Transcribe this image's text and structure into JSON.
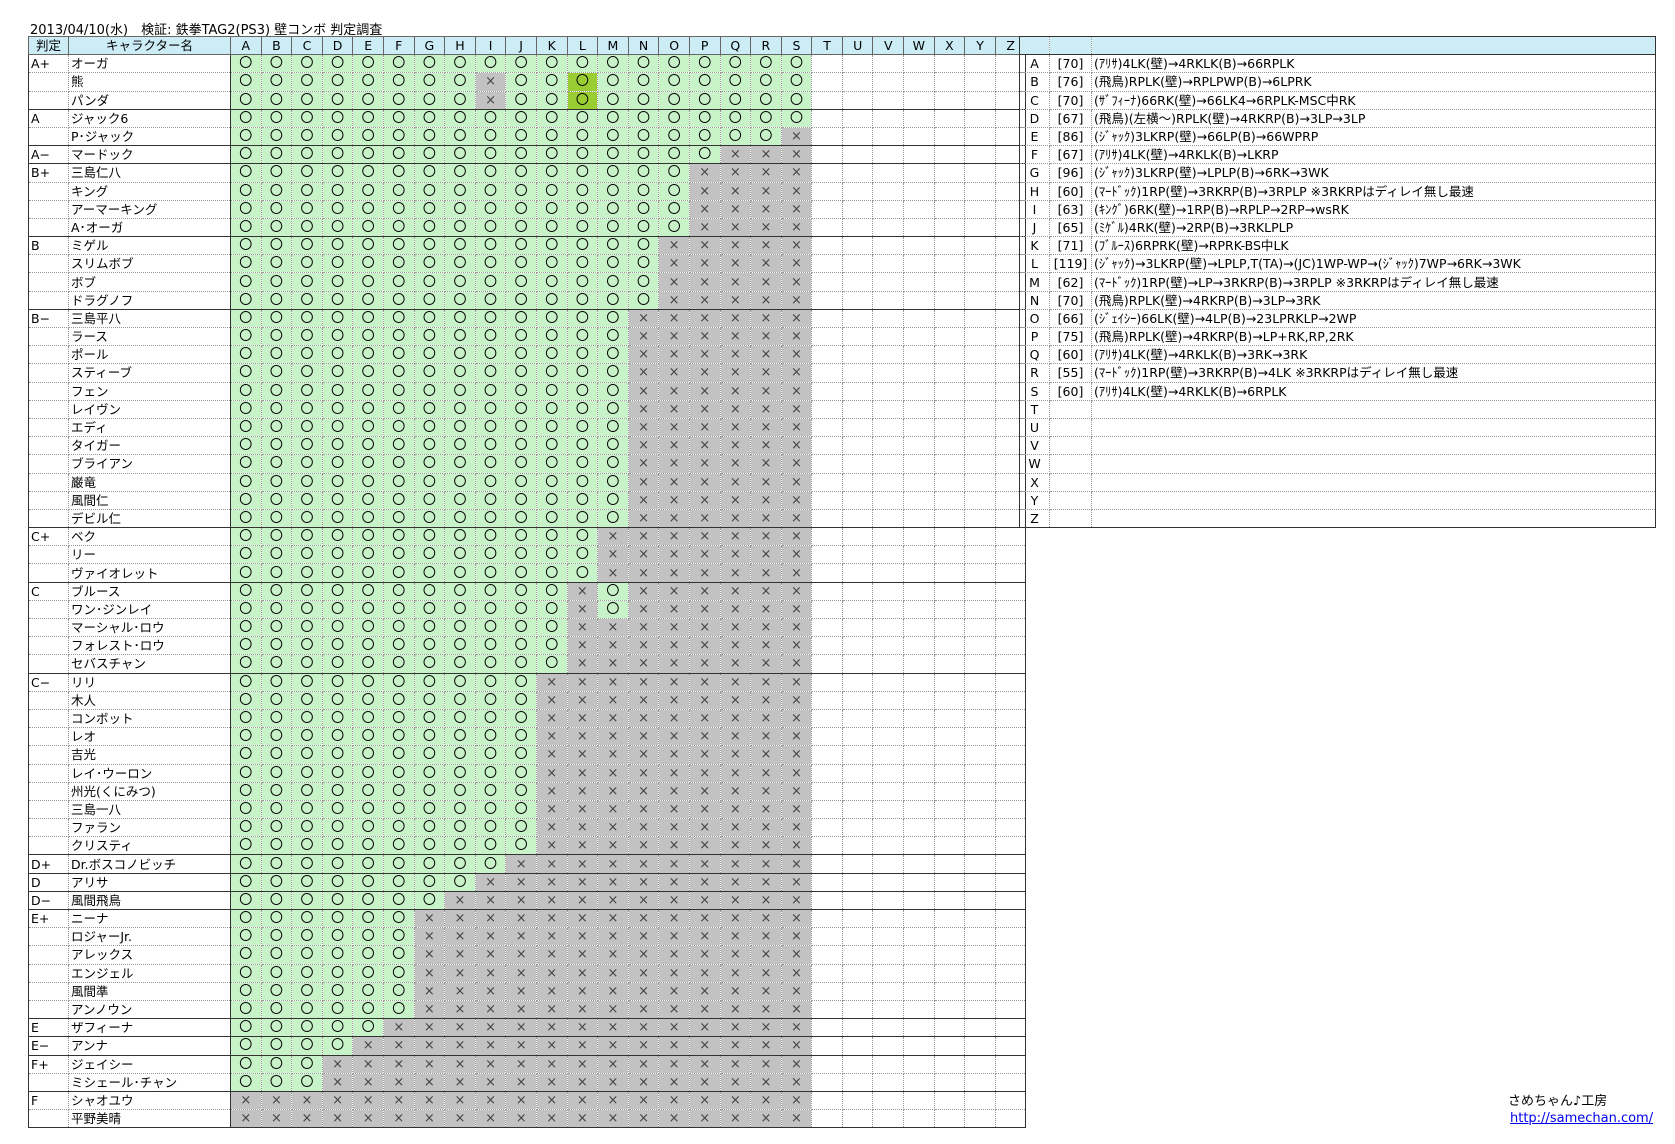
{
  "title": "2013/04/10(水)　検証: 鉄拳TAG2(PS3) 壁コンボ 判定調査",
  "header": {
    "rank": "判定",
    "name": "キャラクター名",
    "letters": [
      "A",
      "B",
      "C",
      "D",
      "E",
      "F",
      "G",
      "H",
      "I",
      "J",
      "K",
      "L",
      "M",
      "N",
      "O",
      "P",
      "Q",
      "R",
      "S",
      "T",
      "U",
      "V",
      "W",
      "X",
      "Y",
      "Z"
    ]
  },
  "symbols": {
    "o": "〇",
    "x": "×"
  },
  "rows": [
    {
      "rank": "A+",
      "name": "オーガ",
      "res": "ooooooooooooooooooo"
    },
    {
      "rank": "",
      "name": "熊",
      "res": "ooooooooxoohooooooo"
    },
    {
      "rank": "",
      "name": "パンダ",
      "res": "ooooooooxoohooooooo"
    },
    {
      "rank": "A",
      "name": "ジャック6",
      "res": "ooooooooooooooooooo"
    },
    {
      "rank": "",
      "name": "P･ジャック",
      "res": "oooooooooooooooooox"
    },
    {
      "rank": "A−",
      "name": "マードック",
      "res": "ooooooooooooooooxxx"
    },
    {
      "rank": "B+",
      "name": "三島仁八",
      "res": "oooooooooooooooxxxx"
    },
    {
      "rank": "",
      "name": "キング",
      "res": "oooooooooooooooxxxx"
    },
    {
      "rank": "",
      "name": "アーマーキング",
      "res": "oooooooooooooooxxxx"
    },
    {
      "rank": "",
      "name": "A･オーガ",
      "res": "oooooooooooooooxxxx"
    },
    {
      "rank": "B",
      "name": "ミゲル",
      "res": "ooooooooooooooxxxxx"
    },
    {
      "rank": "",
      "name": "スリムボブ",
      "res": "ooooooooooooooxxxxx"
    },
    {
      "rank": "",
      "name": "ボブ",
      "res": "ooooooooooooooxxxxx"
    },
    {
      "rank": "",
      "name": "ドラグノフ",
      "res": "ooooooooooooooxxxxx"
    },
    {
      "rank": "B−",
      "name": "三島平八",
      "res": "oooooooooooooxxxxxx"
    },
    {
      "rank": "",
      "name": "ラース",
      "res": "oooooooooooooxxxxxx"
    },
    {
      "rank": "",
      "name": "ポール",
      "res": "oooooooooooooxxxxxx"
    },
    {
      "rank": "",
      "name": "スティーブ",
      "res": "oooooooooooooxxxxxx"
    },
    {
      "rank": "",
      "name": "フェン",
      "res": "oooooooooooooxxxxxx"
    },
    {
      "rank": "",
      "name": "レイヴン",
      "res": "oooooooooooooxxxxxx"
    },
    {
      "rank": "",
      "name": "エディ",
      "res": "oooooooooooooxxxxxx"
    },
    {
      "rank": "",
      "name": "タイガー",
      "res": "oooooooooooooxxxxxx"
    },
    {
      "rank": "",
      "name": "ブライアン",
      "res": "oooooooooooooxxxxxx"
    },
    {
      "rank": "",
      "name": "巌竜",
      "res": "oooooooooooooxxxxxx"
    },
    {
      "rank": "",
      "name": "風間仁",
      "res": "oooooooooooooxxxxxx"
    },
    {
      "rank": "",
      "name": "デビル仁",
      "res": "oooooooooooooxxxxxx"
    },
    {
      "rank": "C+",
      "name": "ベク",
      "res": "ooooooooooooxxxxxxx"
    },
    {
      "rank": "",
      "name": "リー",
      "res": "ooooooooooooxxxxxxx"
    },
    {
      "rank": "",
      "name": "ヴァイオレット",
      "res": "ooooooooooooxxxxxxx"
    },
    {
      "rank": "C",
      "name": "ブルース",
      "res": "oooooooooooxoxxxxxx"
    },
    {
      "rank": "",
      "name": "ワン･ジンレイ",
      "res": "oooooooooooxoxxxxxx"
    },
    {
      "rank": "",
      "name": "マーシャル･ロウ",
      "res": "oooooooooooxxxxxxxx"
    },
    {
      "rank": "",
      "name": "フォレスト･ロウ",
      "res": "oooooooooooxxxxxxxx"
    },
    {
      "rank": "",
      "name": "セバスチャン",
      "res": "oooooooooooxxxxxxxx"
    },
    {
      "rank": "C−",
      "name": "リリ",
      "res": "ooooooooooxxxxxxxxx"
    },
    {
      "rank": "",
      "name": "木人",
      "res": "ooooooooooxxxxxxxxx"
    },
    {
      "rank": "",
      "name": "コンボット",
      "res": "ooooooooooxxxxxxxxx"
    },
    {
      "rank": "",
      "name": "レオ",
      "res": "ooooooooooxxxxxxxxx"
    },
    {
      "rank": "",
      "name": "吉光",
      "res": "ooooooooooxxxxxxxxx"
    },
    {
      "rank": "",
      "name": "レイ･ウーロン",
      "res": "ooooooooooxxxxxxxxx"
    },
    {
      "rank": "",
      "name": "州光(くにみつ)",
      "res": "ooooooooooxxxxxxxxx"
    },
    {
      "rank": "",
      "name": "三島一八",
      "res": "ooooooooooxxxxxxxxx"
    },
    {
      "rank": "",
      "name": "ファラン",
      "res": "ooooooooooxxxxxxxxx"
    },
    {
      "rank": "",
      "name": "クリスティ",
      "res": "ooooooooooxxxxxxxxx"
    },
    {
      "rank": "D+",
      "name": "Dr.ボスコノビッチ",
      "res": "oooooooooxxxxxxxxxx"
    },
    {
      "rank": "D",
      "name": "アリサ",
      "res": "ooooooooxxxxxxxxxxx"
    },
    {
      "rank": "D−",
      "name": "風間飛鳥",
      "res": "oooooooxxxxxxxxxxxx"
    },
    {
      "rank": "E+",
      "name": "ニーナ",
      "res": "ooooooxxxxxxxxxxxxx"
    },
    {
      "rank": "",
      "name": "ロジャーJr.",
      "res": "ooooooxxxxxxxxxxxxx"
    },
    {
      "rank": "",
      "name": "アレックス",
      "res": "ooooooxxxxxxxxxxxxx"
    },
    {
      "rank": "",
      "name": "エンジェル",
      "res": "ooooooxxxxxxxxxxxxx"
    },
    {
      "rank": "",
      "name": "風間準",
      "res": "ooooooxxxxxxxxxxxxx"
    },
    {
      "rank": "",
      "name": "アンノウン",
      "res": "ooooooxxxxxxxxxxxxx"
    },
    {
      "rank": "E",
      "name": "ザフィーナ",
      "res": "oooooxxxxxxxxxxxxxx"
    },
    {
      "rank": "E−",
      "name": "アンナ",
      "res": "ooooxxxxxxxxxxxxxxx"
    },
    {
      "rank": "F+",
      "name": "ジェイシー",
      "res": "oooxxxxxxxxxxxxxxxx"
    },
    {
      "rank": "",
      "name": "ミシェール･チャン",
      "res": "oooxxxxxxxxxxxxxxxx"
    },
    {
      "rank": "F",
      "name": "シャオユウ",
      "res": "xxxxxxxxxxxxxxxxxxx"
    },
    {
      "rank": "",
      "name": "平野美晴",
      "res": "xxxxxxxxxxxxxxxxxxx"
    }
  ],
  "legend": [
    {
      "key": "A",
      "num": "[70]",
      "text": "(ｱﾘｻ)4LK(壁)→4RKLK(B)→66RPLK"
    },
    {
      "key": "B",
      "num": "[76]",
      "text": "(飛鳥)RPLK(壁)→RPLPWP(B)→6LPRK"
    },
    {
      "key": "C",
      "num": "[70]",
      "text": "(ｻﾞﾌｨｰﾅ)66RK(壁)→66LK4→6RPLK-MSC中RK"
    },
    {
      "key": "D",
      "num": "[67]",
      "text": "(飛鳥)(左横～)RPLK(壁)→4RKRP(B)→3LP→3LP"
    },
    {
      "key": "E",
      "num": "[86]",
      "text": "(ｼﾞｬｯｸ)3LKRP(壁)→66LP(B)→66WPRP"
    },
    {
      "key": "F",
      "num": "[67]",
      "text": "(ｱﾘｻ)4LK(壁)→4RKLK(B)→LKRP"
    },
    {
      "key": "G",
      "num": "[96]",
      "text": "(ｼﾞｬｯｸ)3LKRP(壁)→LPLP(B)→6RK→3WK"
    },
    {
      "key": "H",
      "num": "[60]",
      "text": "(ﾏｰﾄﾞｯｸ)1RP(壁)→3RKRP(B)→3RPLP ※3RKRPはディレイ無し最速"
    },
    {
      "key": "I",
      "num": "[63]",
      "text": "(ｷﾝｸﾞ)6RK(壁)→1RP(B)→RPLP→2RP→wsRK"
    },
    {
      "key": "J",
      "num": "[65]",
      "text": "(ﾐｹﾞﾙ)4RK(壁)→2RP(B)→3RKLPLP"
    },
    {
      "key": "K",
      "num": "[71]",
      "text": "(ﾌﾞﾙｰｽ)6RPRK(壁)→RPRK-BS中LK"
    },
    {
      "key": "L",
      "num": "[119]",
      "text": "(ｼﾞｬｯｸ)→3LKRP(壁)→LPLP,T(TA)→(JC)1WP-WP→(ｼﾞｬｯｸ)7WP→6RK→3WK"
    },
    {
      "key": "M",
      "num": "[62]",
      "text": "(ﾏｰﾄﾞｯｸ)1RP(壁)→LP→3RKRP(B)→3RPLP ※3RKRPはディレイ無し最速"
    },
    {
      "key": "N",
      "num": "[70]",
      "text": "(飛鳥)RPLK(壁)→4RKRP(B)→3LP→3RK"
    },
    {
      "key": "O",
      "num": "[66]",
      "text": "(ｼﾞｪｲｼｰ)66LK(壁)→4LP(B)→23LPRKLP→2WP"
    },
    {
      "key": "P",
      "num": "[75]",
      "text": "(飛鳥)RPLK(壁)→4RKRP(B)→LP+RK,RP,2RK"
    },
    {
      "key": "Q",
      "num": "[60]",
      "text": "(ｱﾘｻ)4LK(壁)→4RKLK(B)→3RK→3RK"
    },
    {
      "key": "R",
      "num": "[55]",
      "text": "(ﾏｰﾄﾞｯｸ)1RP(壁)→3RKRP(B)→4LK ※3RKRPはディレイ無し最速"
    },
    {
      "key": "S",
      "num": "[60]",
      "text": "(ｱﾘｻ)4LK(壁)→4RKLK(B)→6RPLK"
    },
    {
      "key": "T",
      "num": "",
      "text": ""
    },
    {
      "key": "U",
      "num": "",
      "text": ""
    },
    {
      "key": "V",
      "num": "",
      "text": ""
    },
    {
      "key": "W",
      "num": "",
      "text": ""
    },
    {
      "key": "X",
      "num": "",
      "text": ""
    },
    {
      "key": "Y",
      "num": "",
      "text": ""
    },
    {
      "key": "Z",
      "num": "",
      "text": ""
    }
  ],
  "author": "さめちゃん♪工房",
  "url": "http://samechan.com/",
  "colors": {
    "ok": "#c8f2c8",
    "ng": "#c2c2c2",
    "highlight": "#9acd32",
    "header": "#ccecf6"
  }
}
